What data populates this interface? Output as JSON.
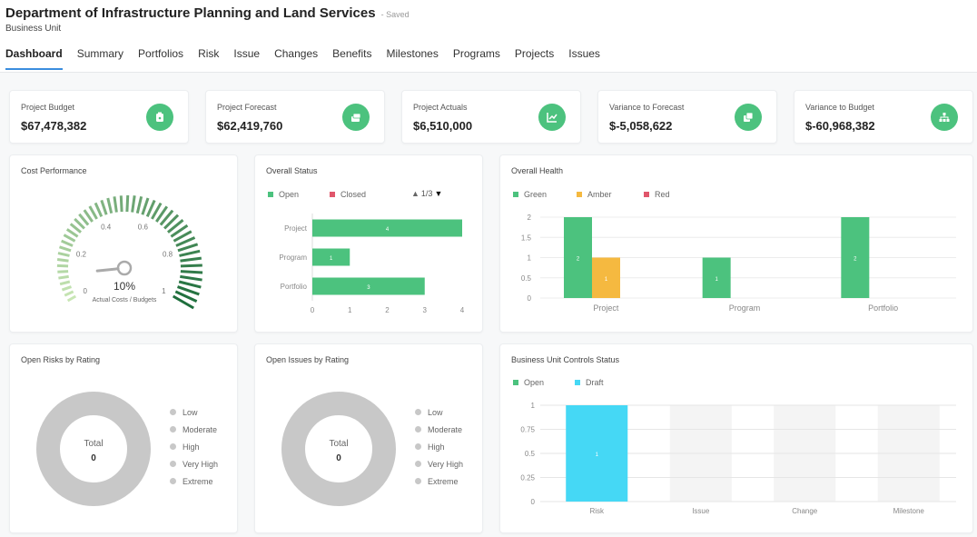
{
  "header": {
    "title": "Department of Infrastructure Planning and Land Services",
    "saved": "- Saved",
    "subtitle": "Business Unit"
  },
  "tabs": [
    "Dashboard",
    "Summary",
    "Portfolios",
    "Risk",
    "Issue",
    "Changes",
    "Benefits",
    "Milestones",
    "Programs",
    "Projects",
    "Issues"
  ],
  "kpis": [
    {
      "label": "Project Budget",
      "value": "$67,478,382",
      "icon": "wallet-icon"
    },
    {
      "label": "Project Forecast",
      "value": "$62,419,760",
      "icon": "coins-icon"
    },
    {
      "label": "Project Actuals",
      "value": "$6,510,000",
      "icon": "line-chart-icon"
    },
    {
      "label": "Variance to Forecast",
      "value": "$-5,058,622",
      "icon": "copy-icon"
    },
    {
      "label": "Variance to Budget",
      "value": "$-60,968,382",
      "icon": "org-chart-icon"
    }
  ],
  "colors": {
    "green": "#4cc27e",
    "amber": "#f5b940",
    "red": "#e0566b",
    "cyan": "#45d8f5",
    "grey": "#c8c8c8"
  },
  "cost_performance": {
    "title": "Cost Performance",
    "value": "10%",
    "fraction": 0.1,
    "caption": "Actual Costs / Budgets",
    "ticks": [
      "0",
      "0.2",
      "0.4",
      "0.6",
      "0.8",
      "1"
    ]
  },
  "overall_status": {
    "title": "Overall Status",
    "legend": [
      "Open",
      "Closed"
    ],
    "pager": "1/3",
    "chart_data": {
      "type": "bar",
      "orientation": "horizontal",
      "categories": [
        "Project",
        "Program",
        "Portfolio"
      ],
      "series": [
        {
          "name": "Open",
          "values": [
            4,
            1,
            3
          ]
        }
      ],
      "xlim": [
        0,
        4
      ],
      "xticks": [
        "0",
        "1",
        "2",
        "3",
        "4"
      ]
    }
  },
  "overall_health": {
    "title": "Overall Health",
    "legend": [
      "Green",
      "Amber",
      "Red"
    ],
    "chart_data": {
      "type": "bar",
      "categories": [
        "Project",
        "Program",
        "Portfolio"
      ],
      "series": [
        {
          "name": "Green",
          "values": [
            2,
            1,
            2
          ]
        },
        {
          "name": "Amber",
          "values": [
            1,
            0,
            0
          ]
        },
        {
          "name": "Red",
          "values": [
            0,
            0,
            0
          ]
        }
      ],
      "ylim": [
        0,
        2
      ],
      "yticks": [
        "0",
        "0.5",
        "1",
        "1.5",
        "2"
      ]
    }
  },
  "open_risks": {
    "title": "Open Risks by Rating",
    "total_label": "Total",
    "total_value": "0",
    "legend": [
      "Low",
      "Moderate",
      "High",
      "Very High",
      "Extreme"
    ]
  },
  "open_issues": {
    "title": "Open Issues by Rating",
    "total_label": "Total",
    "total_value": "0",
    "legend": [
      "Low",
      "Moderate",
      "High",
      "Very High",
      "Extreme"
    ]
  },
  "controls": {
    "title": "Business Unit Controls Status",
    "legend": [
      "Open",
      "Draft"
    ],
    "chart_data": {
      "type": "bar",
      "categories": [
        "Risk",
        "Issue",
        "Change",
        "Milestone"
      ],
      "series": [
        {
          "name": "Open",
          "values": [
            0,
            0,
            0,
            0
          ]
        },
        {
          "name": "Draft",
          "values": [
            1,
            0,
            0,
            0
          ]
        }
      ],
      "ylim": [
        0,
        1
      ],
      "yticks": [
        "0",
        "0.25",
        "0.5",
        "0.75",
        "1"
      ]
    }
  }
}
